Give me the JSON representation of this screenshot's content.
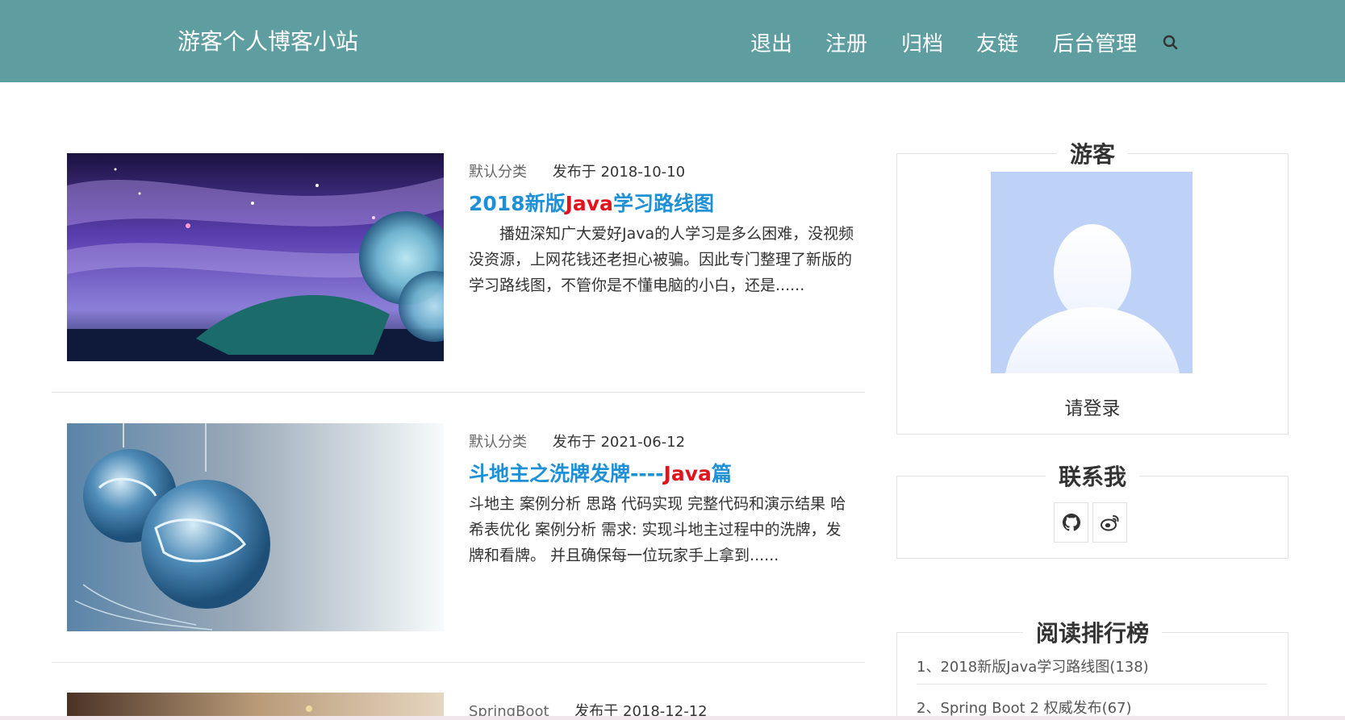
{
  "header": {
    "site_title": "游客个人博客小站",
    "nav": [
      "退出",
      "注册",
      "归档",
      "友链",
      "后台管理"
    ],
    "search_icon": "search-icon",
    "background": "#5f9ea0"
  },
  "posts": [
    {
      "category": "默认分类",
      "date": "发布于 2018-10-10",
      "title_before": "2018新版",
      "title_highlight": "Java",
      "title_after": "学习路线图",
      "excerpt": "　　播妞深知广大爱好Java的人学习是多么困难，没视频没资源，上网花钱还老担心被骗。因此专门整理了新版的学习路线图，不管你是不懂电脑的小白，还是......"
    },
    {
      "category": "默认分类",
      "date": "发布于 2021-06-12",
      "title_before": "斗地主之洗牌发牌----",
      "title_highlight": "Java",
      "title_after": "篇",
      "excerpt": "斗地主 案例分析 思路 代码实现 完整代码和演示结果 哈希表优化 案例分析 需求: 实现斗地主过程中的洗牌，发牌和看牌。 并且确保每一位玩家手上拿到......"
    },
    {
      "category": "SpringBoot",
      "date": "发布于 2018-12-12"
    }
  ],
  "sidebar": {
    "profile": {
      "title": "游客",
      "login_label": "请登录"
    },
    "contact": {
      "title": "联系我",
      "icons": [
        "github-icon",
        "weibo-icon"
      ]
    },
    "ranking": {
      "title": "阅读排行榜",
      "items": [
        "1、2018新版Java学习路线图(138)",
        "2、Spring Boot 2 权威发布(67)"
      ]
    }
  },
  "colors": {
    "title_link": "#1e90d6",
    "highlight": "#e0141e"
  }
}
